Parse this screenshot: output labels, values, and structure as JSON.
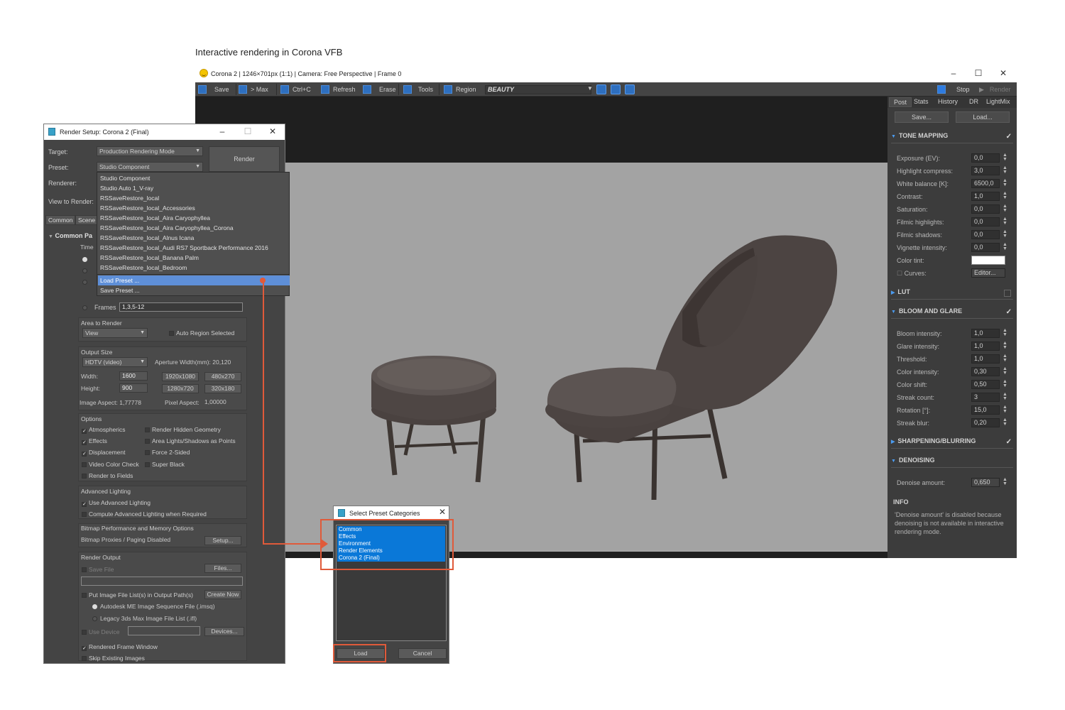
{
  "caption": "Interactive rendering in Corona VFB",
  "vfb": {
    "title": "Corona 2 | 1246×701px (1:1) | Camera: Free Perspective | Frame 0",
    "toolbar": {
      "save": "Save",
      "to_max": "> Max",
      "copy": "Ctrl+C",
      "refresh": "Refresh",
      "erase": "Erase",
      "tools": "Tools",
      "region": "Region",
      "channel": "BEAUTY",
      "stop": "Stop",
      "render": "Render"
    },
    "side_tabs": [
      "Post",
      "Stats",
      "History",
      "DR",
      "LightMix"
    ],
    "save_btn": "Save...",
    "load_btn": "Load...",
    "tone_mapping": {
      "header": "TONE MAPPING",
      "rows": [
        {
          "label": "Exposure (EV):",
          "value": "0,0"
        },
        {
          "label": "Highlight compress:",
          "value": "3,0"
        },
        {
          "label": "White balance [K]:",
          "value": "6500,0"
        },
        {
          "label": "Contrast:",
          "value": "1,0"
        },
        {
          "label": "Saturation:",
          "value": "0,0"
        },
        {
          "label": "Filmic highlights:",
          "value": "0,0"
        },
        {
          "label": "Filmic shadows:",
          "value": "0,0"
        },
        {
          "label": "Vignette intensity:",
          "value": "0,0"
        }
      ],
      "color_tint": "Color tint:",
      "curves": "Curves:",
      "editor": "Editor..."
    },
    "lut_header": "LUT",
    "bloom": {
      "header": "BLOOM AND GLARE",
      "rows": [
        {
          "label": "Bloom intensity:",
          "value": "1,0"
        },
        {
          "label": "Glare intensity:",
          "value": "1,0"
        },
        {
          "label": "Threshold:",
          "value": "1,0"
        },
        {
          "label": "Color intensity:",
          "value": "0,30"
        },
        {
          "label": "Color shift:",
          "value": "0,50"
        },
        {
          "label": "Streak count:",
          "value": "3"
        },
        {
          "label": "Rotation [°]:",
          "value": "15,0"
        },
        {
          "label": "Streak blur:",
          "value": "0,20"
        }
      ]
    },
    "sharpening_header": "SHARPENING/BLURRING",
    "denoising": {
      "header": "DENOISING",
      "label": "Denoise amount:",
      "value": "0,650"
    },
    "info": {
      "header": "INFO",
      "text": "'Denoise amount' is disabled because denoising is not available in interactive rendering mode."
    }
  },
  "render_setup": {
    "title": "Render Setup: Corona 2 (Final)",
    "target_label": "Target:",
    "target_value": "Production Rendering Mode",
    "preset_label": "Preset:",
    "preset_value": "Studio Component",
    "renderer_label": "Renderer:",
    "view_label": "View to Render:",
    "render_btn": "Render",
    "tabs": [
      "Common",
      "Scene"
    ],
    "common_params": "Common Pa",
    "time_label": "Time",
    "frames_label": "Frames",
    "frames_value": "1,3,5-12",
    "area_label": "Area to Render",
    "area_value": "View",
    "auto_region": "Auto Region Selected",
    "output_size": "Output Size",
    "output_preset": "HDTV (video)",
    "aperture": "Aperture Width(mm): 20,120",
    "width_label": "Width:",
    "width_value": "1600",
    "height_label": "Height:",
    "height_value": "900",
    "res_buttons": [
      "1920x1080",
      "480x270",
      "1280x720",
      "320x180"
    ],
    "image_aspect": "Image Aspect: 1,77778",
    "pixel_aspect_label": "Pixel Aspect:",
    "pixel_aspect_value": "1,00000",
    "options_label": "Options",
    "options_left": [
      "Atmospherics",
      "Effects",
      "Displacement",
      "Video Color Check",
      "Render to Fields"
    ],
    "options_right": [
      "Render Hidden Geometry",
      "Area Lights/Shadows as Points",
      "Force 2-Sided",
      "Super Black"
    ],
    "adv_lighting": "Advanced Lighting",
    "use_adv": "Use Advanced Lighting",
    "compute_adv": "Compute Advanced Lighting when Required",
    "bitmap_label": "Bitmap Performance and Memory Options",
    "bitmap_proxies": "Bitmap Proxies / Paging Disabled",
    "setup_btn": "Setup...",
    "render_output": "Render Output",
    "save_file": "Save File",
    "files_btn": "Files...",
    "put_image": "Put Image File List(s) in Output Path(s)",
    "create_now": "Create Now",
    "autodesk": "Autodesk ME Image Sequence File (.imsq)",
    "legacy": "Legacy 3ds Max Image File List (.ifl)",
    "use_device": "Use Device",
    "devices_btn": "Devices...",
    "rendered_frame": "Rendered Frame Window",
    "skip_existing": "Skip Existing Images"
  },
  "preset_dropdown": {
    "items": [
      "Studio Component",
      "Studio Auto 1_V-ray",
      "RSSaveRestore_local",
      "RSSaveRestore_local_Accessories",
      "RSSaveRestore_local_Aira Caryophyllea",
      "RSSaveRestore_local_Aira Caryophyllea_Corona",
      "RSSaveRestore_local_Alnus Icana",
      "RSSaveRestore_local_Audi RS7 Sportback Performance 2016",
      "RSSaveRestore_local_Banana Palm",
      "RSSaveRestore_local_Bedroom"
    ],
    "load": "Load Preset ...",
    "save": "Save Preset ..."
  },
  "preset_categories": {
    "title": "Select Preset Categories",
    "items": [
      "Common",
      "Effects",
      "Environment",
      "Render Elements",
      "Corona 2 (Final)"
    ],
    "load": "Load",
    "cancel": "Cancel"
  }
}
